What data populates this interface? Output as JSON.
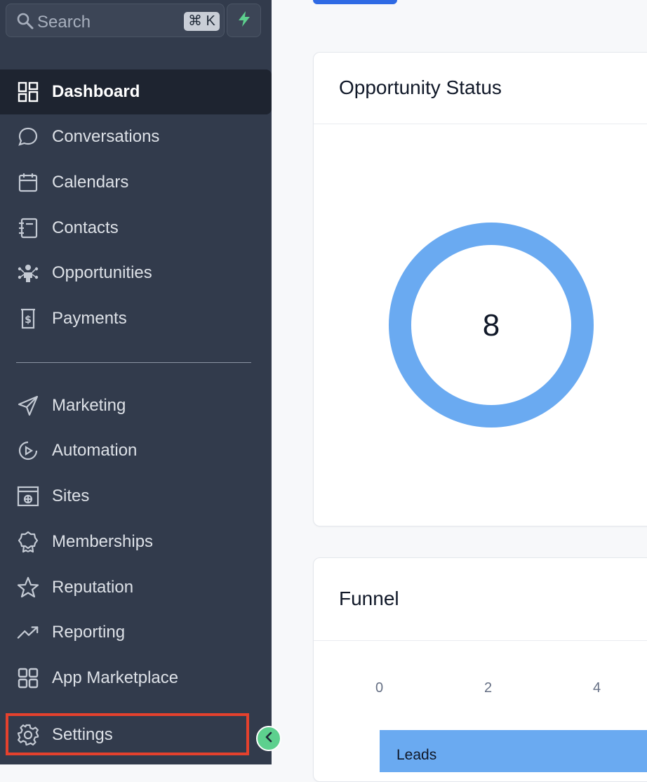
{
  "search": {
    "placeholder": "Search",
    "shortcut": "⌘ K"
  },
  "nav": {
    "dashboard": "Dashboard",
    "conversations": "Conversations",
    "calendars": "Calendars",
    "contacts": "Contacts",
    "opportunities": "Opportunities",
    "payments": "Payments",
    "marketing": "Marketing",
    "automation": "Automation",
    "sites": "Sites",
    "memberships": "Memberships",
    "reputation": "Reputation",
    "reporting": "Reporting",
    "app_marketplace": "App Marketplace",
    "settings": "Settings"
  },
  "opportunity_status": {
    "title": "Opportunity Status",
    "total": "8"
  },
  "funnel": {
    "title": "Funnel",
    "ticks": [
      "0",
      "2",
      "4"
    ],
    "bar_label": "Leads"
  },
  "colors": {
    "sidebar": "#323b4c",
    "active_item": "#1e2430",
    "donut": "#6aaaf1",
    "accent_green": "#5dd08e",
    "highlight_red": "#e5412d"
  }
}
